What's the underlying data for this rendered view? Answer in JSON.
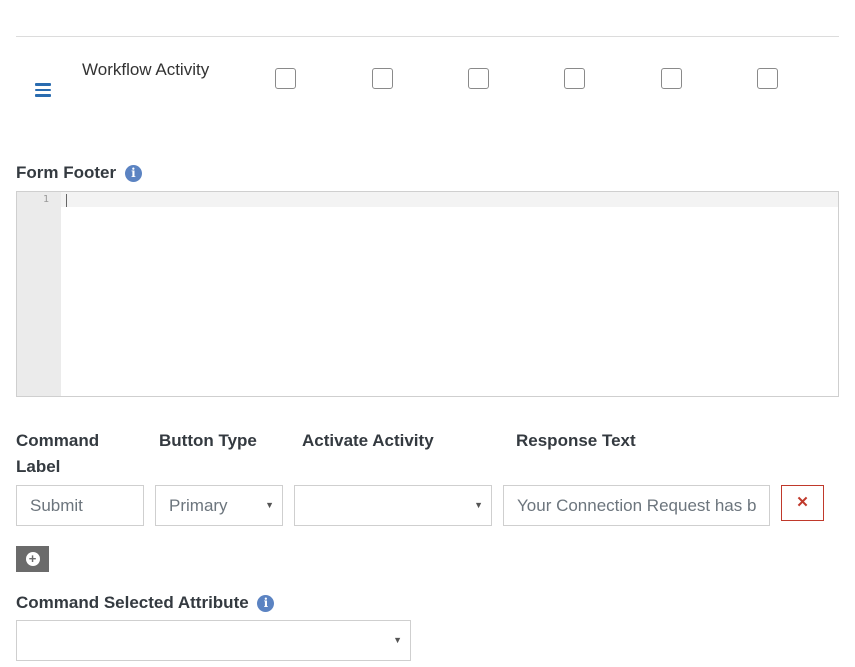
{
  "workflow_row": {
    "label": "Workflow Activity",
    "checkboxes": [
      false,
      false,
      false,
      false,
      false,
      false
    ]
  },
  "form_footer": {
    "label": "Form Footer",
    "info_icon": "info",
    "editor": {
      "line_numbers": [
        "1"
      ],
      "content": ""
    }
  },
  "commands": {
    "headers": {
      "command_label_line1": "Command",
      "command_label_line2": "Label",
      "button_type": "Button Type",
      "activate_activity": "Activate Activity",
      "response_text": "Response Text"
    },
    "row": {
      "command_label_placeholder": "Submit",
      "button_type_value": "Primary",
      "activate_activity_value": "",
      "response_text_value": "Your Connection Request has b"
    },
    "remove_symbol": "✕",
    "add_symbol": "+"
  },
  "command_selected_attribute": {
    "label": "Command Selected Attribute",
    "value": ""
  },
  "colors": {
    "accent_blue": "#2a6cb0",
    "info_icon": "#5b83c2",
    "remove_red": "#c0392b",
    "add_button": "#6b6b6b"
  }
}
